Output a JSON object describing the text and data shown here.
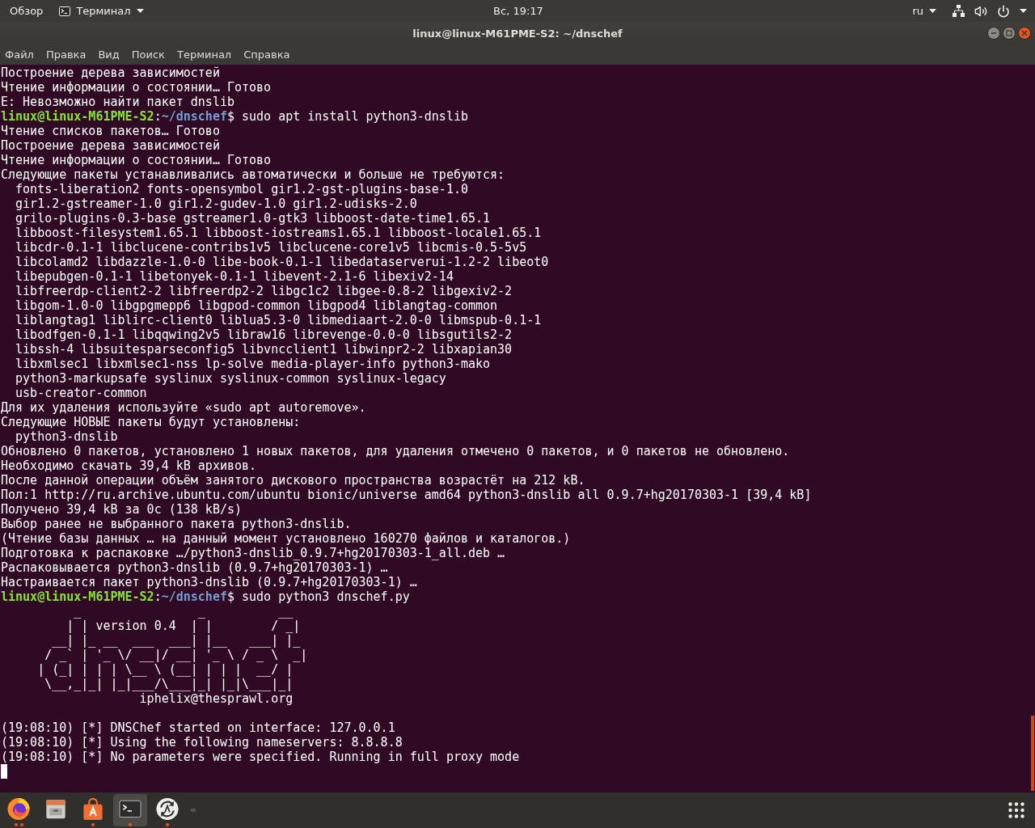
{
  "top_bar": {
    "activities": "Обзор",
    "app_menu": "Терминал",
    "clock": "Вс, 19:17",
    "keyboard_layout": "ru"
  },
  "window": {
    "title": "linux@linux-M61PME-S2: ~/dnschef"
  },
  "menu": [
    "Файл",
    "Правка",
    "Вид",
    "Поиск",
    "Терминал",
    "Справка"
  ],
  "terminal": {
    "lines": [
      {
        "kind": "output",
        "text": "Построение дерева зависимостей"
      },
      {
        "kind": "output",
        "text": "Чтение информации о состоянии… Готово"
      },
      {
        "kind": "output",
        "text": "E: Невозможно найти пакет dnslib"
      },
      {
        "kind": "prompt",
        "user": "linux@linux-M61PME-S2",
        "sep": ":",
        "cwd": "~/dnschef",
        "sigil": "$",
        "command": "sudo apt install python3-dnslib"
      },
      {
        "kind": "output",
        "text": "Чтение списков пакетов… Готово"
      },
      {
        "kind": "output",
        "text": "Построение дерева зависимостей"
      },
      {
        "kind": "output",
        "text": "Чтение информации о состоянии… Готово"
      },
      {
        "kind": "output",
        "text": "Следующие пакеты устанавливались автоматически и больше не требуются:"
      },
      {
        "kind": "output",
        "text": "  fonts-liberation2 fonts-opensymbol gir1.2-gst-plugins-base-1.0"
      },
      {
        "kind": "output",
        "text": "  gir1.2-gstreamer-1.0 gir1.2-gudev-1.0 gir1.2-udisks-2.0"
      },
      {
        "kind": "output",
        "text": "  grilo-plugins-0.3-base gstreamer1.0-gtk3 libboost-date-time1.65.1"
      },
      {
        "kind": "output",
        "text": "  libboost-filesystem1.65.1 libboost-iostreams1.65.1 libboost-locale1.65.1"
      },
      {
        "kind": "output",
        "text": "  libcdr-0.1-1 libclucene-contribs1v5 libclucene-core1v5 libcmis-0.5-5v5"
      },
      {
        "kind": "output",
        "text": "  libcolamd2 libdazzle-1.0-0 libe-book-0.1-1 libedataserverui-1.2-2 libeot0"
      },
      {
        "kind": "output",
        "text": "  libepubgen-0.1-1 libetonyek-0.1-1 libevent-2.1-6 libexiv2-14"
      },
      {
        "kind": "output",
        "text": "  libfreerdp-client2-2 libfreerdp2-2 libgc1c2 libgee-0.8-2 libgexiv2-2"
      },
      {
        "kind": "output",
        "text": "  libgom-1.0-0 libgpgmepp6 libgpod-common libgpod4 liblangtag-common"
      },
      {
        "kind": "output",
        "text": "  liblangtag1 liblirc-client0 liblua5.3-0 libmediaart-2.0-0 libmspub-0.1-1"
      },
      {
        "kind": "output",
        "text": "  libodfgen-0.1-1 libqqwing2v5 libraw16 librevenge-0.0-0 libsgutils2-2"
      },
      {
        "kind": "output",
        "text": "  libssh-4 libsuitesparseconfig5 libvncclient1 libwinpr2-2 libxapian30"
      },
      {
        "kind": "output",
        "text": "  libxmlsec1 libxmlsec1-nss lp-solve media-player-info python3-mako"
      },
      {
        "kind": "output",
        "text": "  python3-markupsafe syslinux syslinux-common syslinux-legacy"
      },
      {
        "kind": "output",
        "text": "  usb-creator-common"
      },
      {
        "kind": "output",
        "text": "Для их удаления используйте «sudo apt autoremove»."
      },
      {
        "kind": "output",
        "text": "Следующие НОВЫЕ пакеты будут установлены:"
      },
      {
        "kind": "output",
        "text": "  python3-dnslib"
      },
      {
        "kind": "output",
        "text": "Обновлено 0 пакетов, установлено 1 новых пакетов, для удаления отмечено 0 пакетов, и 0 пакетов не обновлено."
      },
      {
        "kind": "output",
        "text": "Необходимо скачать 39,4 kB архивов."
      },
      {
        "kind": "output",
        "text": "После данной операции объём занятого дискового пространства возрастёт на 212 kB."
      },
      {
        "kind": "output",
        "text": "Пол:1 http://ru.archive.ubuntu.com/ubuntu bionic/universe amd64 python3-dnslib all 0.9.7+hg20170303-1 [39,4 kB]"
      },
      {
        "kind": "output",
        "text": "Получено 39,4 kB за 0с (138 kB/s)"
      },
      {
        "kind": "output",
        "text": "Выбор ранее не выбранного пакета python3-dnslib."
      },
      {
        "kind": "output",
        "text": "(Чтение базы данных … на данный момент установлено 160270 файлов и каталогов.)"
      },
      {
        "kind": "output",
        "text": "Подготовка к распаковке …/python3-dnslib_0.9.7+hg20170303-1_all.deb …"
      },
      {
        "kind": "output",
        "text": "Распаковывается python3-dnslib (0.9.7+hg20170303-1) …"
      },
      {
        "kind": "output",
        "text": "Настраивается пакет python3-dnslib (0.9.7+hg20170303-1) …"
      },
      {
        "kind": "prompt",
        "user": "linux@linux-M61PME-S2",
        "sep": ":",
        "cwd": "~/dnschef",
        "sigil": "$",
        "command": "sudo python3 dnschef.py"
      },
      {
        "kind": "banner",
        "text": "          _                _          __"
      },
      {
        "kind": "banner",
        "text": "         | | version 0.4  | |        / _|"
      },
      {
        "kind": "banner",
        "text": "       __| |_ __  ___  ___| |__   ___| |_"
      },
      {
        "kind": "banner",
        "text": "      / _` | '_ \\/ __|/ __| '_ \\ / _ \\  _|"
      },
      {
        "kind": "banner",
        "text": "     | (_| | | | \\__ \\ (__| | | |  __/ |"
      },
      {
        "kind": "banner",
        "text": "      \\__,_|_| |_|___/\\___|_| |_|\\___|_|"
      },
      {
        "kind": "banner",
        "text": "                   iphelix@thesprawl.org"
      },
      {
        "kind": "blank"
      },
      {
        "kind": "output",
        "text": "(19:08:10) [*] DNSChef started on interface: 127.0.0.1"
      },
      {
        "kind": "output",
        "text": "(19:08:10) [*] Using the following nameservers: 8.8.8.8"
      },
      {
        "kind": "output",
        "text": "(19:08:10) [*] No parameters were specified. Running in full proxy mode"
      }
    ],
    "cursor": true
  },
  "dock": {
    "items": [
      {
        "kind": "browser",
        "running": true,
        "multiple": true,
        "selected": false
      },
      {
        "kind": "files",
        "running": false,
        "multiple": false,
        "selected": false
      },
      {
        "kind": "software",
        "running": true,
        "multiple": false,
        "selected": false
      },
      {
        "kind": "terminal",
        "running": true,
        "multiple": false,
        "selected": true
      },
      {
        "kind": "updater",
        "running": true,
        "multiple": false,
        "selected": false
      }
    ]
  }
}
